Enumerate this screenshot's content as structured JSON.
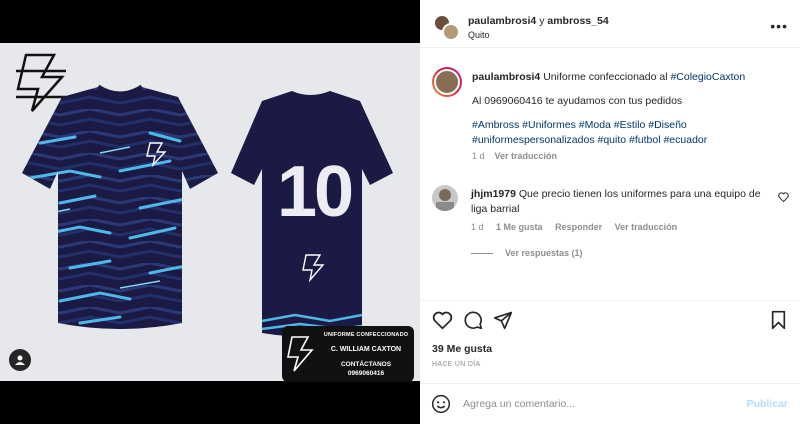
{
  "post": {
    "header": {
      "user1": "paulambrosi4",
      "connector": "y",
      "user2": "ambross_54",
      "location": "Quito"
    },
    "caption": {
      "user": "paulambrosi4",
      "text": "Uniforme confeccionado al",
      "mention": "#ColegioCaxton",
      "line2": "Al 0969060416 te ayudamos con tus pedidos",
      "hashtags_line1": "#Ambross #Uniformes #Moda #Estilo #Diseño",
      "hashtags_line2": "#uniformespersonalizados #quito #futbol #ecuador",
      "time": "1 d",
      "translate": "Ver traducción"
    },
    "comment": {
      "user": "jhjm1979",
      "text": "Que precio tienen los uniformes para una equipo de liga barrial",
      "time": "1 d",
      "likes": "1 Me gusta",
      "reply": "Responder",
      "translate": "Ver traducción",
      "view_replies": "Ver respuestas (1)"
    },
    "likes": "39 Me gusta",
    "posted": "HACE UN DÍA",
    "add_comment_placeholder": "Agrega un comentario...",
    "publish": "Publicar"
  },
  "media": {
    "jersey_number": "10",
    "card": {
      "line1": "UNIFORME CONFECCIONADO",
      "line2": "C. WILLIAM CAXTON",
      "line3": "CONTÁCTANOS",
      "line4": "0969060416"
    }
  },
  "colors": {
    "jersey_navy": "#1a1a44",
    "stripe_cyan": "#4fb8e8",
    "link": "#00376b"
  },
  "icons": [
    "more-icon",
    "heart-icon",
    "comment-icon",
    "share-icon",
    "bookmark-icon",
    "emoji-icon",
    "user-tag-icon"
  ]
}
